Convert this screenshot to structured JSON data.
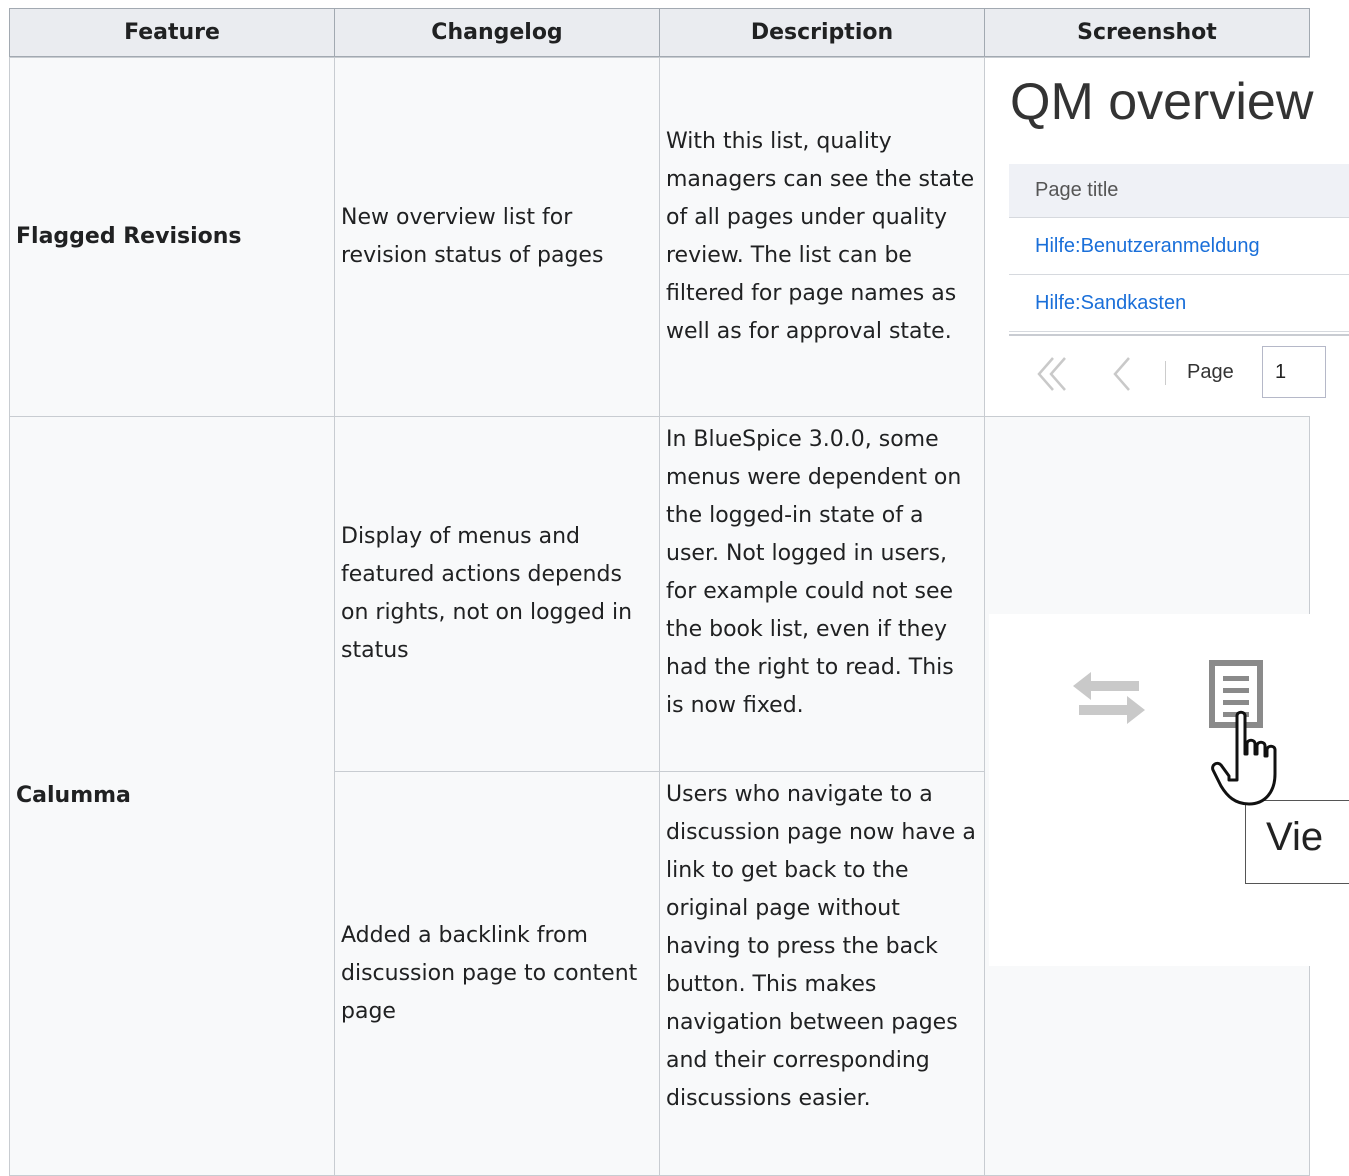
{
  "table": {
    "headers": [
      "Feature",
      "Changelog",
      "Description",
      "Screenshot"
    ],
    "rows": [
      {
        "feature": "Flagged Revisions",
        "changelog": "New overview list for revision status of pages",
        "description": "With this list, quality managers can see the state of all pages under quality review. The list can be filtered for page names as well as for approval state."
      },
      {
        "feature": "Calumma",
        "changelog": "Display of menus and featured actions depends on rights, not on logged in status",
        "description": "In BlueSpice 3.0.0, some menus were dependent on the logged-in state of a user. Not logged in users, for example could not see the book list, even if they had the right to read. This is now fixed."
      },
      {
        "changelog": "Added a backlink from discussion page to content page",
        "description": "Users who navigate to a discussion page now have a link to get back to the original page without having to press the back button. This makes navigation between pages and their corresponding discussions easier."
      }
    ]
  },
  "qm_screenshot": {
    "title": "QM overview",
    "column_header": "Page title",
    "links": [
      "Hilfe:Benutzeranmeldung",
      "Hilfe:Sandkasten"
    ],
    "page_label": "Page",
    "page_value": "1"
  },
  "calumma_screenshot": {
    "tooltip_text": "Vie",
    "icons": [
      "swap-arrows-icon",
      "document-list-icon",
      "hand-cursor-icon"
    ]
  }
}
